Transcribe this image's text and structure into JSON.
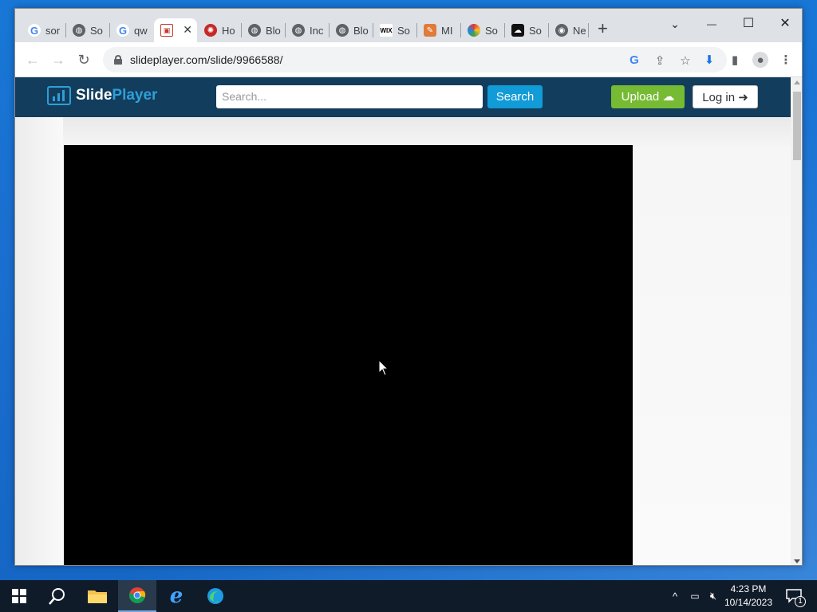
{
  "browser": {
    "tabs": [
      {
        "label": "sor",
        "icon": "google-icon"
      },
      {
        "label": "So",
        "icon": "globe-icon"
      },
      {
        "label": "qw",
        "icon": "google-icon"
      },
      {
        "label": "",
        "icon": "slideplayer-icon",
        "active": true
      },
      {
        "label": "Ho",
        "icon": "red-lifebuoy-icon"
      },
      {
        "label": "Blo",
        "icon": "globe-icon"
      },
      {
        "label": "Inc",
        "icon": "globe-icon"
      },
      {
        "label": "Blo",
        "icon": "globe-icon"
      },
      {
        "label": "So",
        "icon": "wix-icon"
      },
      {
        "label": "MI",
        "icon": "paint-icon"
      },
      {
        "label": "So",
        "icon": "color-eye-icon"
      },
      {
        "label": "So",
        "icon": "cloud-upload-icon"
      },
      {
        "label": "Ne",
        "icon": "chrome-icon"
      }
    ],
    "active_tab_close": "✕",
    "new_tab": "+",
    "url": "slideplayer.com/slide/9966588/",
    "window_controls": {
      "tab_search": "⌄",
      "minimize": "—",
      "maximize": "☐",
      "close": "✕"
    }
  },
  "site": {
    "logo_slide": "Slide",
    "logo_player": "Player",
    "search_placeholder": "Search...",
    "search_button": "Search",
    "upload_button": "Upload",
    "login_button": "Log in"
  },
  "taskbar": {
    "apps": [
      "start",
      "search",
      "file-explorer",
      "chrome",
      "internet-explorer",
      "edge"
    ],
    "time": "4:23 PM",
    "date": "10/14/2023",
    "notification_count": "1"
  },
  "colors": {
    "header_bg": "#133d5d",
    "search_btn": "#119bd7",
    "upload_btn": "#76bb33",
    "desktop": "#1877d6"
  }
}
